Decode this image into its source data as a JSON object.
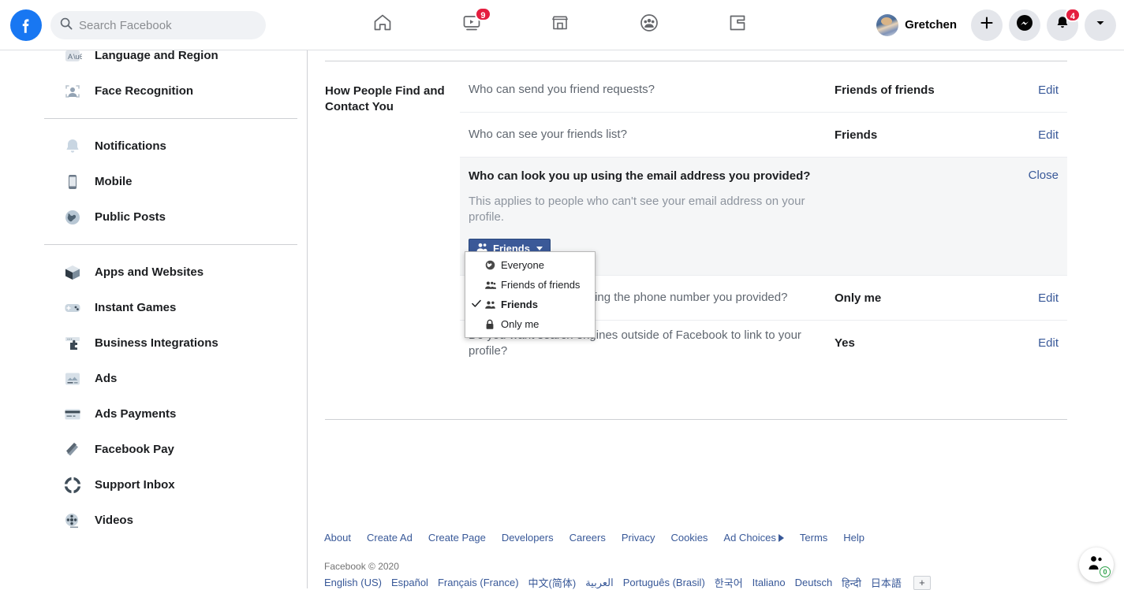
{
  "topbar": {
    "logo": "facebook-logo",
    "search": {
      "placeholder": "Search Facebook",
      "value": ""
    },
    "nav": [
      {
        "name": "home",
        "icon": "home-icon",
        "badge": ""
      },
      {
        "name": "watch",
        "icon": "watch-icon",
        "badge": "9"
      },
      {
        "name": "marketplace",
        "icon": "marketplace-icon",
        "badge": ""
      },
      {
        "name": "groups",
        "icon": "groups-icon",
        "badge": ""
      },
      {
        "name": "gaming",
        "icon": "gaming-icon",
        "badge": ""
      }
    ],
    "profile_name": "Gretchen",
    "actions": [
      {
        "name": "create",
        "icon": "plus-icon",
        "badge": ""
      },
      {
        "name": "messenger",
        "icon": "messenger-icon",
        "badge": ""
      },
      {
        "name": "notifications",
        "icon": "bell-icon",
        "badge": "4"
      },
      {
        "name": "account-menu",
        "icon": "chevron-down-icon",
        "badge": ""
      }
    ]
  },
  "sidebar": {
    "groups": [
      {
        "items": [
          {
            "label": "Language and Region",
            "icon": "language-icon"
          },
          {
            "label": "Face Recognition",
            "icon": "face-recognition-icon"
          }
        ]
      },
      {
        "items": [
          {
            "label": "Notifications",
            "icon": "bell-icon"
          },
          {
            "label": "Mobile",
            "icon": "mobile-icon"
          },
          {
            "label": "Public Posts",
            "icon": "globe-icon"
          }
        ]
      },
      {
        "items": [
          {
            "label": "Apps and Websites",
            "icon": "cube-icon"
          },
          {
            "label": "Instant Games",
            "icon": "gamepad-icon"
          },
          {
            "label": "Business Integrations",
            "icon": "puzzle-icon"
          },
          {
            "label": "Ads",
            "icon": "ads-icon"
          },
          {
            "label": "Ads Payments",
            "icon": "credit-card-icon"
          },
          {
            "label": "Facebook Pay",
            "icon": "wallet-icon"
          },
          {
            "label": "Support Inbox",
            "icon": "lifebuoy-icon"
          },
          {
            "label": "Videos",
            "icon": "film-reel-icon"
          }
        ]
      }
    ]
  },
  "main": {
    "section_title": "How People Find and Contact You",
    "rows": [
      {
        "question": "Who can send you friend requests?",
        "value": "Friends of friends",
        "action": "Edit"
      },
      {
        "question": "Who can see your friends list?",
        "value": "Friends",
        "action": "Edit"
      }
    ],
    "expanded": {
      "question": "Who can look you up using the email address you provided?",
      "close_label": "Close",
      "description": "This applies to people who can't see your email address on your profile.",
      "button_label": "Friends",
      "button_icon": "friends-icon",
      "button_color": "#3b5998",
      "dropdown": {
        "options": [
          {
            "label": "Everyone",
            "icon": "globe-icon",
            "selected": false
          },
          {
            "label": "Friends of friends",
            "icon": "friends-group-icon",
            "selected": false
          },
          {
            "label": "Friends",
            "icon": "friends-icon",
            "selected": true
          },
          {
            "label": "Only me",
            "icon": "lock-icon",
            "selected": false
          }
        ]
      }
    },
    "rows_after": [
      {
        "question": "Who can look you up using the phone number you provided?",
        "value": "Only me",
        "action": "Edit"
      },
      {
        "question": "Do you want search engines outside of Facebook to link to your profile?",
        "value": "Yes",
        "action": "Edit"
      }
    ]
  },
  "footer": {
    "links": [
      "About",
      "Create Ad",
      "Create Page",
      "Developers",
      "Careers",
      "Privacy",
      "Cookies",
      "Ad Choices",
      "Terms",
      "Help"
    ],
    "ad_choices_index": 7,
    "copyright": "Facebook © 2020",
    "languages": [
      "English (US)",
      "Español",
      "Français (France)",
      "中文(简体)",
      "العربية",
      "Português (Brasil)",
      "한국어",
      "Italiano",
      "Deutsch",
      "हिन्दी",
      "日本語"
    ],
    "add_language_label": "+"
  },
  "contacts_fab": {
    "icon": "contacts-icon",
    "badge": "0",
    "badge_color": "#31a24c"
  }
}
